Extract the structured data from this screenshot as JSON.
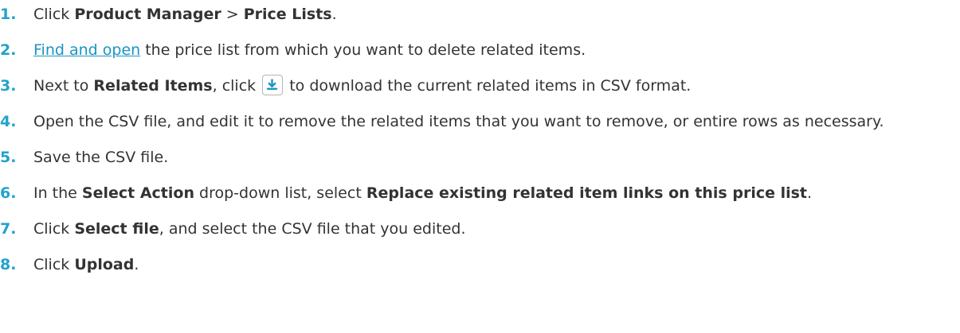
{
  "steps": [
    {
      "num": "1.",
      "t1": "Click ",
      "b1": "Product Manager",
      "t2": " > ",
      "b2": "Price Lists",
      "t3": "."
    },
    {
      "num": "2.",
      "link": "Find and open",
      "t1": " the price list from which you want to delete related items."
    },
    {
      "num": "3.",
      "t1": "Next to ",
      "b1": "Related Items",
      "t2": ", click ",
      "t3": " to download the current related items in CSV format.",
      "icon": "download-icon"
    },
    {
      "num": "4.",
      "t1": "Open the CSV file, and edit it to remove the related items that you want to remove, or entire rows as necessary."
    },
    {
      "num": "5.",
      "t1": "Save the CSV file."
    },
    {
      "num": "6.",
      "t1": "In the ",
      "b1": "Select Action",
      "t2": " drop-down list, select ",
      "b2": "Replace existing related item links on this price list",
      "t3": "."
    },
    {
      "num": "7.",
      "t1": "Click ",
      "b1": "Select file",
      "t2": ", and select the CSV file that you edited."
    },
    {
      "num": "8.",
      "t1": "Click ",
      "b1": "Upload",
      "t2": "."
    }
  ],
  "colors": {
    "step_number": "#22a3c9",
    "link": "#1a94c4",
    "icon": "#1a94c4"
  }
}
